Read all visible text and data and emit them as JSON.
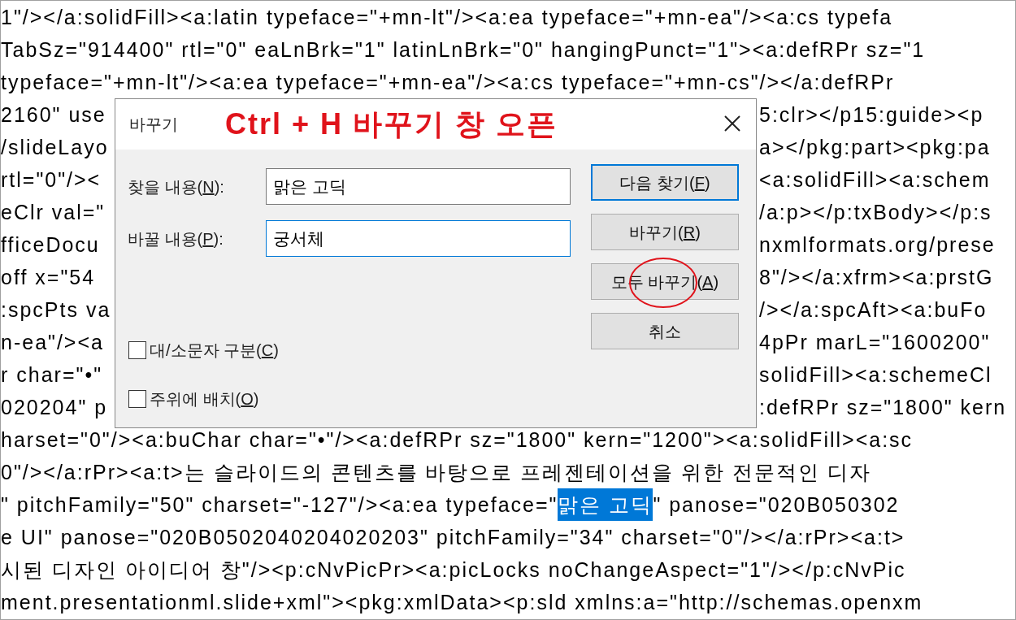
{
  "editor": {
    "lines": [
      {
        "segments": [
          {
            "text": "1\"/></a:solidFill><a:latin typeface=\"+mn-lt\"/><a:ea typeface=\"+mn-ea\"/><a:cs typefa",
            "selected": false
          }
        ]
      },
      {
        "segments": [
          {
            "text": "TabSz=\"914400\" rtl=\"0\" eaLnBrk=\"1\" latinLnBrk=\"0\" hangingPunct=\"1\"><a:defRPr sz=\"1",
            "selected": false
          }
        ]
      },
      {
        "segments": [
          {
            "text": "typeface=\"+mn-lt\"/><a:ea typeface=\"+mn-ea\"/><a:cs typeface=\"+mn-cs\"/></a:defRPr",
            "selected": false
          }
        ]
      },
      {
        "segments": [
          {
            "text": "2160\" use",
            "selected": false
          }
        ],
        "right": "5:clr></p15:guide><p"
      },
      {
        "segments": [
          {
            "text": "/slideLayo",
            "selected": false
          }
        ],
        "right": "a></pkg:part><pkg:pa"
      },
      {
        "segments": [
          {
            "text": "rtl=\"0\"/><",
            "selected": false
          }
        ],
        "right": "<a:solidFill><a:schem"
      },
      {
        "segments": [
          {
            "text": "eClr val=\"",
            "selected": false
          }
        ],
        "right": "/a:p></p:txBody></p:s"
      },
      {
        "segments": [
          {
            "text": "fficeDocu",
            "selected": false
          }
        ],
        "right": "nxmlformats.org/prese"
      },
      {
        "segments": [
          {
            "text": "off x=\"54",
            "selected": false
          }
        ],
        "right": "8\"/></a:xfrm><a:prstG"
      },
      {
        "segments": [
          {
            "text": ":spcPts va",
            "selected": false
          }
        ],
        "right": "/></a:spcAft><a:buFo"
      },
      {
        "segments": [
          {
            "text": "n-ea\"/><a",
            "selected": false
          }
        ],
        "right": "4pPr marL=\"1600200\""
      },
      {
        "segments": [
          {
            "text": "r char=\"•\"",
            "selected": false
          }
        ],
        "right": "solidFill><a:schemeCl"
      },
      {
        "segments": [
          {
            "text": "020204\" p",
            "selected": false
          }
        ],
        "right": ":defRPr sz=\"1800\" kern"
      },
      {
        "segments": [
          {
            "text": "harset=\"0\"/><a:buChar char=\"•\"/><a:defRPr sz=\"1800\" kern=\"1200\"><a:solidFill><a:sc",
            "selected": false
          }
        ]
      },
      {
        "segments": [
          {
            "text": "0\"/></a:rPr><a:t>는 슬라이드의 콘텐츠를 바탕으로 프레젠테이션을 위한 전문적인 디자",
            "selected": false
          }
        ]
      },
      {
        "segments": [
          {
            "text": "\" pitchFamily=\"50\" charset=\"-127\"/><a:ea typeface=\"",
            "selected": false
          },
          {
            "text": "맑은 고딕",
            "selected": true
          },
          {
            "text": "\" panose=\"020B050302",
            "selected": false
          }
        ]
      },
      {
        "segments": [
          {
            "text": "e UI\" panose=\"020B0502040204020203\" pitchFamily=\"34\" charset=\"0\"/></a:rPr><a:t>",
            "selected": false
          }
        ]
      },
      {
        "segments": [
          {
            "text": "시된 디자인 아이디어 창\"/><p:cNvPicPr><a:picLocks noChangeAspect=\"1\"/></p:cNvPic",
            "selected": false
          }
        ]
      },
      {
        "segments": [
          {
            "text": "ment.presentationml.slide+xml\"><pkg:xmlData><p:sld xmlns:a=\"http://schemas.openxm",
            "selected": false
          }
        ]
      }
    ]
  },
  "dialog": {
    "title": "바꾸기",
    "annotation": "Ctrl + H 바꾸기 창 오픈",
    "fields": [
      {
        "label": "찾을 내용(N):",
        "value": "맑은 고딕",
        "focused": false
      },
      {
        "label": "바꿀 내용(P):",
        "value": "궁서체",
        "focused": true
      }
    ],
    "buttons": [
      {
        "label": "다음 찾기(F)",
        "default": true
      },
      {
        "label": "바꾸기(R)",
        "default": false
      },
      {
        "label": "모두 바꾸기(A)",
        "default": false
      },
      {
        "label": "취소",
        "default": false
      }
    ],
    "checkboxes": [
      {
        "label": "대/소문자 구분(C)",
        "checked": false
      },
      {
        "label": "주위에 배치(O)",
        "checked": false
      }
    ]
  }
}
